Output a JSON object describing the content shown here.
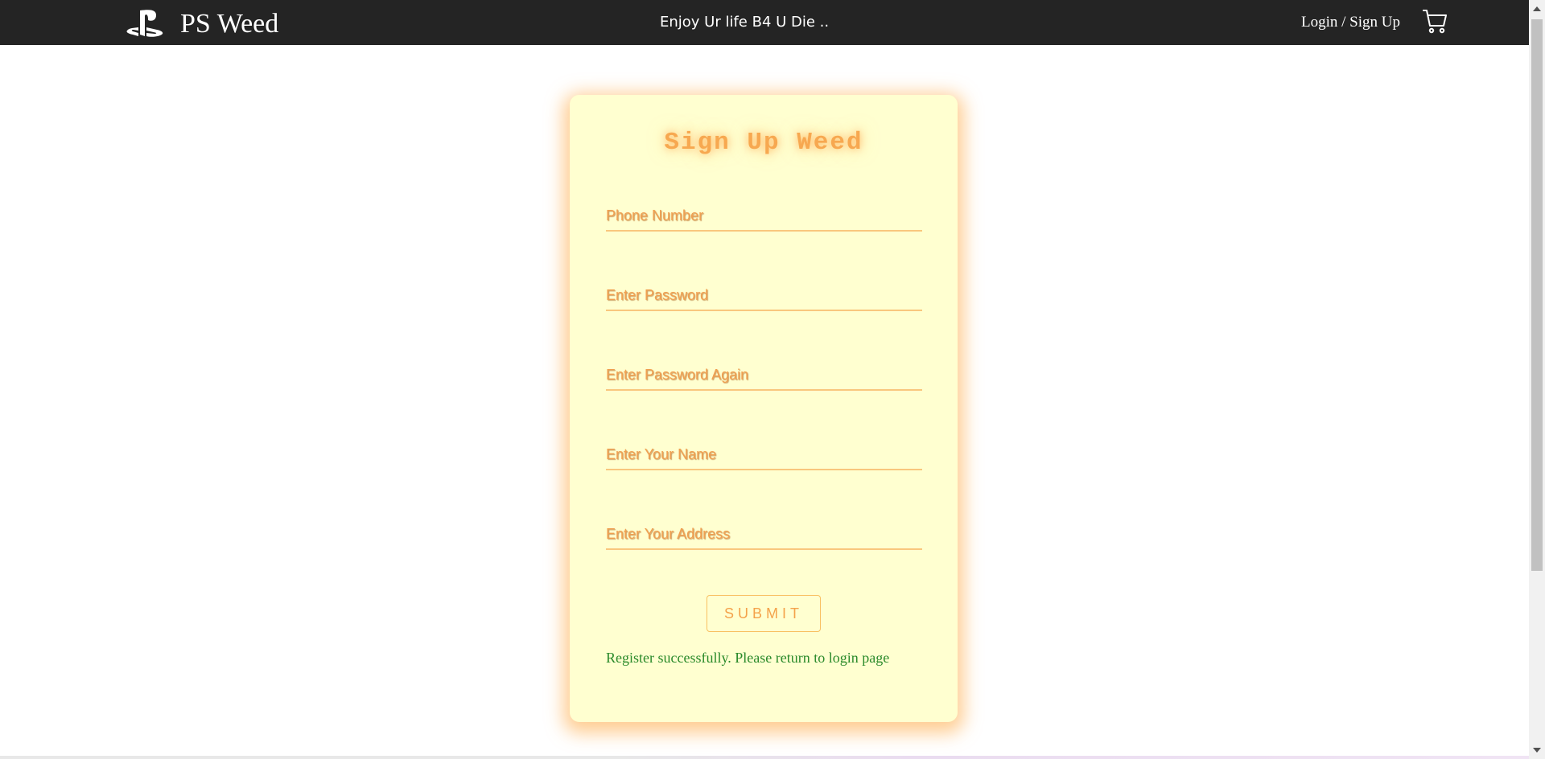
{
  "navbar": {
    "brand_name": "PS Weed",
    "tagline": "Enjoy Ur life B4 U Die ..",
    "login_label": "Login / Sign Up",
    "brand_icon": "playstation-logo-icon",
    "cart_icon": "shopping-cart-icon"
  },
  "form": {
    "title": "Sign Up Weed",
    "fields": [
      {
        "placeholder": "Phone Number",
        "value": ""
      },
      {
        "placeholder": "Enter Password",
        "value": ""
      },
      {
        "placeholder": "Enter Password Again",
        "value": ""
      },
      {
        "placeholder": "Enter Your Name",
        "value": ""
      },
      {
        "placeholder": "Enter Your Address",
        "value": ""
      }
    ],
    "submit_label": "SUBMIT",
    "status_message": "Register successfully. Please return to login page"
  },
  "colors": {
    "navbar_bg": "#242424",
    "card_bg": "#ffffd0",
    "accent": "#f7a850",
    "success": "#2a8a2a"
  }
}
